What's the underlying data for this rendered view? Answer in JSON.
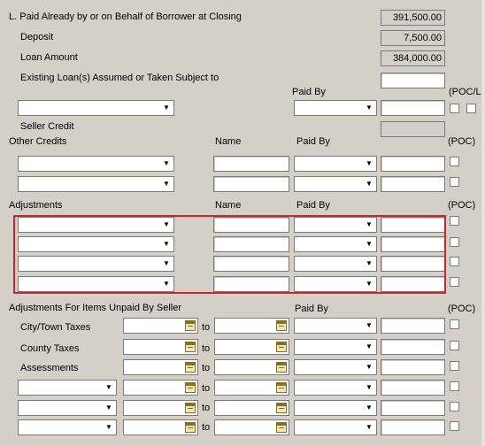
{
  "section_l": {
    "title": "L. Paid Already by or on Behalf of Borrower at Closing",
    "total": "391,500.00",
    "deposit_label": "Deposit",
    "deposit_value": "7,500.00",
    "loan_amount_label": "Loan Amount",
    "loan_amount_value": "384,000.00",
    "existing_loans_label": "Existing Loan(s) Assumed or Taken Subject to",
    "paid_by_header": "Paid By",
    "poc_l_header": "(POC/L)",
    "seller_credit_label": "Seller Credit"
  },
  "other_credits": {
    "title": "Other Credits",
    "name_header": "Name",
    "paid_by_header": "Paid By",
    "poc_header": "(POC)"
  },
  "adjustments": {
    "title": "Adjustments",
    "name_header": "Name",
    "paid_by_header": "Paid By",
    "poc_header": "(POC)"
  },
  "unpaid": {
    "title": "Adjustments For Items Unpaid By Seller",
    "paid_by_header": "Paid By",
    "poc_header": "(POC)",
    "to_label": "to",
    "city_label": "City/Town Taxes",
    "county_label": "County Taxes",
    "assessments_label": "Assessments"
  },
  "icons": {
    "dropdown": "chevron-down-icon",
    "calendar": "calendar-icon"
  },
  "colors": {
    "background": "#d4d0c8",
    "highlight": "#d0222b"
  }
}
